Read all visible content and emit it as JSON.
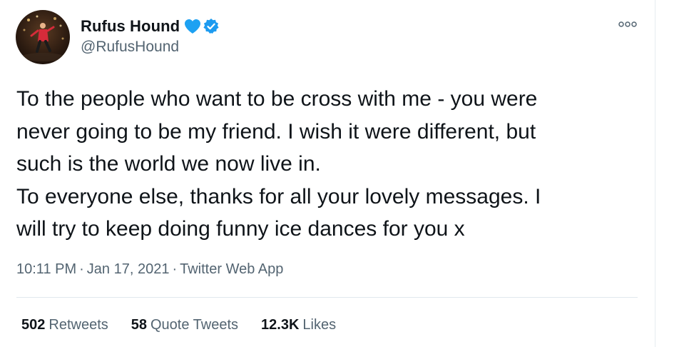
{
  "author": {
    "display_name": "Rufus Hound",
    "handle": "@RufusHound"
  },
  "tweet": {
    "lines": [
      "To the people who want to be cross with me - you were",
      "never going to be my friend. I wish it were different, but",
      "such is the world we now live in.",
      "To everyone else, thanks for all your lovely messages. I",
      "will try to keep doing funny ice dances for you x"
    ]
  },
  "meta": {
    "time": "10:11 PM",
    "separator": "·",
    "date": "Jan 17, 2021",
    "source": "Twitter Web App"
  },
  "stats": {
    "retweets_count": "502",
    "retweets_label": "Retweets",
    "quotes_count": "58",
    "quotes_label": "Quote Tweets",
    "likes_count": "12.3K",
    "likes_label": "Likes"
  },
  "icons": {
    "heart": "blue-heart-icon",
    "verified": "verified-badge-icon",
    "more": "more-options-icon"
  },
  "colors": {
    "heart": "#1da1f2",
    "verified": "#1d9bf0",
    "secondary_text": "#536471",
    "primary_text": "#0f1419"
  }
}
